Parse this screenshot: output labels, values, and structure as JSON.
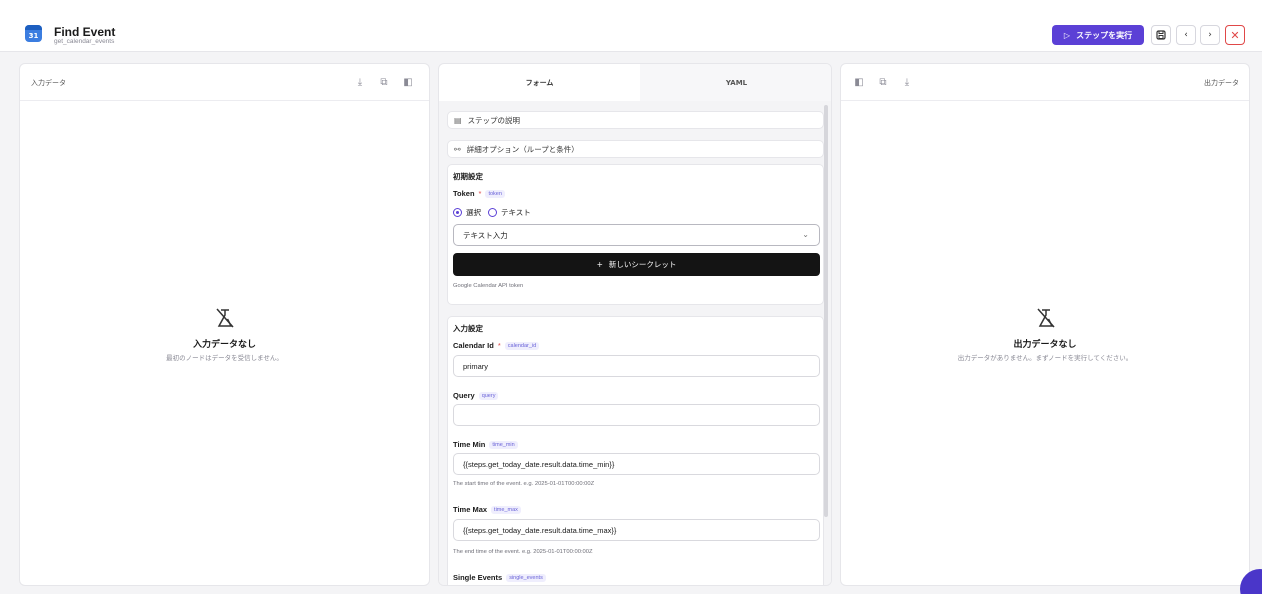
{
  "header": {
    "logo_text": "31",
    "title": "Find Event",
    "subtitle": "get_calendar_events",
    "run_label": "ステップを実行",
    "icons": [
      "play-icon",
      "save-icon",
      "chevron-left-icon",
      "chevron-right-icon",
      "close-icon"
    ]
  },
  "input_panel": {
    "title": "入力データ",
    "empty_title": "入力データなし",
    "empty_sub": "最初のノードはデータを受信しません。",
    "icons": [
      "download-icon",
      "copy-icon",
      "collapse-icon"
    ]
  },
  "output_panel": {
    "title": "出力データ",
    "empty_title": "出力データなし",
    "empty_sub": "出力データがありません。まずノードを実行してください。",
    "icons": [
      "collapse-icon",
      "copy-icon",
      "download-icon"
    ]
  },
  "tabs": [
    {
      "label": "フォーム",
      "active": true
    },
    {
      "label": "YAML",
      "active": false
    }
  ],
  "form": {
    "step_description": "ステップの説明",
    "advanced_options": "詳細オプション（ループと条件）",
    "initial": {
      "title": "初期設定",
      "token": {
        "label": "Token",
        "required_mark": "*",
        "key": "token",
        "radio_select": "選択",
        "radio_text": "テキスト",
        "select_value": "テキスト入力",
        "new_secret": "新しいシークレット",
        "help": "Google Calendar API token"
      }
    },
    "input": {
      "title": "入力設定",
      "calendar_id": {
        "label": "Calendar Id",
        "required_mark": "*",
        "key": "calendar_id",
        "value": "primary"
      },
      "query": {
        "label": "Query",
        "key": "query",
        "value": ""
      },
      "time_min": {
        "label": "Time Min",
        "key": "time_min",
        "value": "{{steps.get_today_date.result.data.time_min}}",
        "help": "The start time of the event. e.g. 2025-01-01T00:00:00Z"
      },
      "time_max": {
        "label": "Time Max",
        "key": "time_max",
        "value": "{{steps.get_today_date.result.data.time_max}}",
        "help": "The end time of the event. e.g. 2025-01-01T00:00:00Z"
      },
      "single_events": {
        "label": "Single Events",
        "key": "single_events"
      }
    }
  },
  "colors": {
    "accent": "#5b40d6",
    "danger": "#e04848",
    "dark": "#141414"
  }
}
